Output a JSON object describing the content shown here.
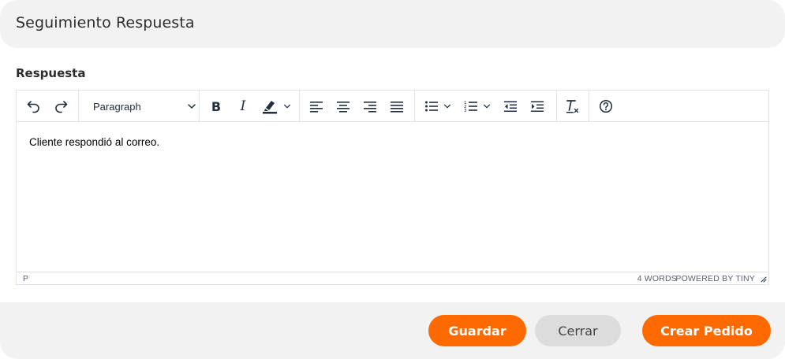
{
  "dialog": {
    "title": "Seguimiento Respuesta"
  },
  "field": {
    "label": "Respuesta"
  },
  "editor": {
    "block_format": "Paragraph",
    "content": "Cliente respondió al correo.",
    "status_path": "P",
    "word_count": "4 WORDS",
    "branding": "POWERED BY TINY",
    "toolbar_icons": [
      "undo-icon",
      "redo-icon",
      "bold-icon",
      "italic-icon",
      "highlight-icon",
      "align-left-icon",
      "align-center-icon",
      "align-right-icon",
      "align-justify-icon",
      "bullet-list-icon",
      "numbered-list-icon",
      "outdent-icon",
      "indent-icon",
      "clear-formatting-icon",
      "help-icon"
    ]
  },
  "footer": {
    "save_label": "Guardar",
    "close_label": "Cerrar",
    "create_order_label": "Crear Pedido"
  },
  "colors": {
    "accent": "#ff6a00",
    "secondary_button": "#dcdcdc",
    "panel": "#f2f2f2"
  }
}
